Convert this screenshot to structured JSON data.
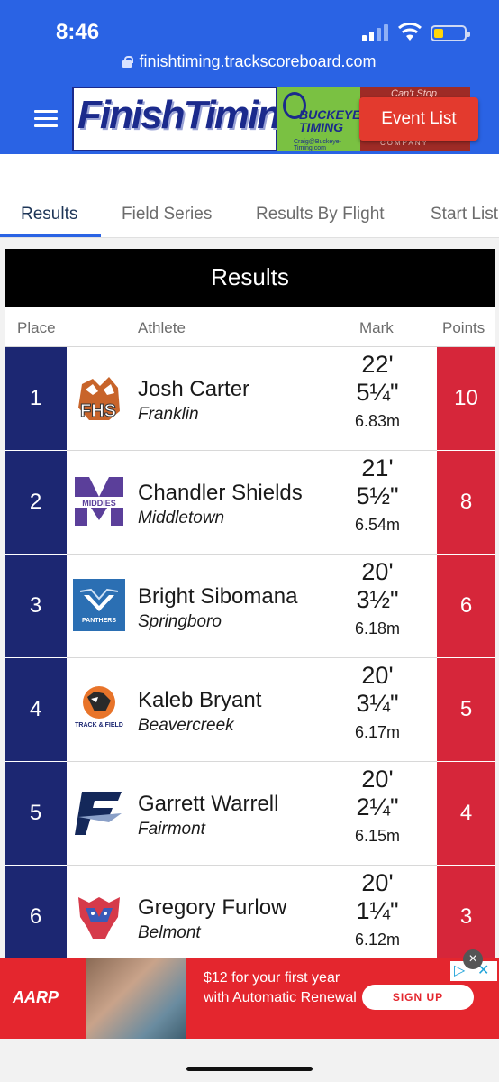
{
  "status_bar": {
    "time": "8:46"
  },
  "browser": {
    "url": "finishtiming.trackscoreboard.com"
  },
  "banner": {
    "finish_timing": "FinishTiming",
    "buckeye": "BUCKEYE TIMING",
    "buckeye_email": "Craig@Buckeye-Timing.com",
    "red_text": "Can't Stop",
    "red_company": "COMPANY"
  },
  "header": {
    "event_list_label": "Event List"
  },
  "tabs": [
    {
      "label": "Results",
      "active": true
    },
    {
      "label": "Field Series"
    },
    {
      "label": "Results By Flight"
    },
    {
      "label": "Start List"
    }
  ],
  "results": {
    "title": "Results",
    "columns": {
      "place": "Place",
      "athlete": "Athlete",
      "mark": "Mark",
      "points": "Points"
    },
    "rows": [
      {
        "place": "1",
        "name": "Josh Carter",
        "school": "Franklin",
        "feet": "22'",
        "inches": "5¼\"",
        "meters": "6.83m",
        "points": "10",
        "logo": "franklin-logo"
      },
      {
        "place": "2",
        "name": "Chandler Shields",
        "school": "Middletown",
        "feet": "21'",
        "inches": "5½\"",
        "meters": "6.54m",
        "points": "8",
        "logo": "middletown-logo"
      },
      {
        "place": "3",
        "name": "Bright Sibomana",
        "school": "Springboro",
        "feet": "20'",
        "inches": "3½\"",
        "meters": "6.18m",
        "points": "6",
        "logo": "springboro-logo"
      },
      {
        "place": "4",
        "name": "Kaleb Bryant",
        "school": "Beavercreek",
        "feet": "20'",
        "inches": "3¼\"",
        "meters": "6.17m",
        "points": "5",
        "logo": "beavercreek-logo"
      },
      {
        "place": "5",
        "name": "Garrett Warrell",
        "school": "Fairmont",
        "feet": "20'",
        "inches": "2¼\"",
        "meters": "6.15m",
        "points": "4",
        "logo": "fairmont-logo"
      },
      {
        "place": "6",
        "name": "Gregory Furlow",
        "school": "Belmont",
        "feet": "20'",
        "inches": "1¼\"",
        "meters": "6.12m",
        "points": "3",
        "logo": "belmont-logo"
      }
    ]
  },
  "ad": {
    "brand": "AARP",
    "text": "$12 for your first year with Automatic Renewal",
    "cta": "SIGN UP"
  },
  "colors": {
    "header_blue": "#2a63e4",
    "place_navy": "#1c2772",
    "points_red": "#d6263a",
    "event_button": "#e33a2e",
    "ad_red": "#e4262e"
  }
}
